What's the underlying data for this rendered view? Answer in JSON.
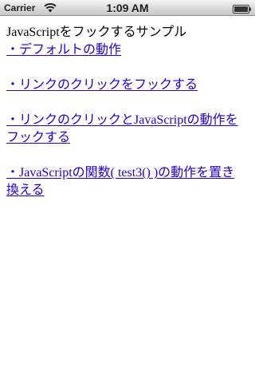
{
  "status_bar": {
    "carrier": "Carrier",
    "time": "1:09 AM",
    "wifi_icon": "wifi-icon",
    "battery_icon": "battery-icon"
  },
  "page": {
    "heading": "JavaScriptをフックするサンプル",
    "links": [
      "・デフォルトの動作",
      "・リンクのクリックをフックする",
      "・リンクのクリックとJavaScriptの動作をフックする",
      "・JavaScriptの関数( test3() )の動作を置き換える"
    ]
  },
  "colors": {
    "link": "#2200cc",
    "text": "#000000",
    "background": "#ffffff"
  }
}
